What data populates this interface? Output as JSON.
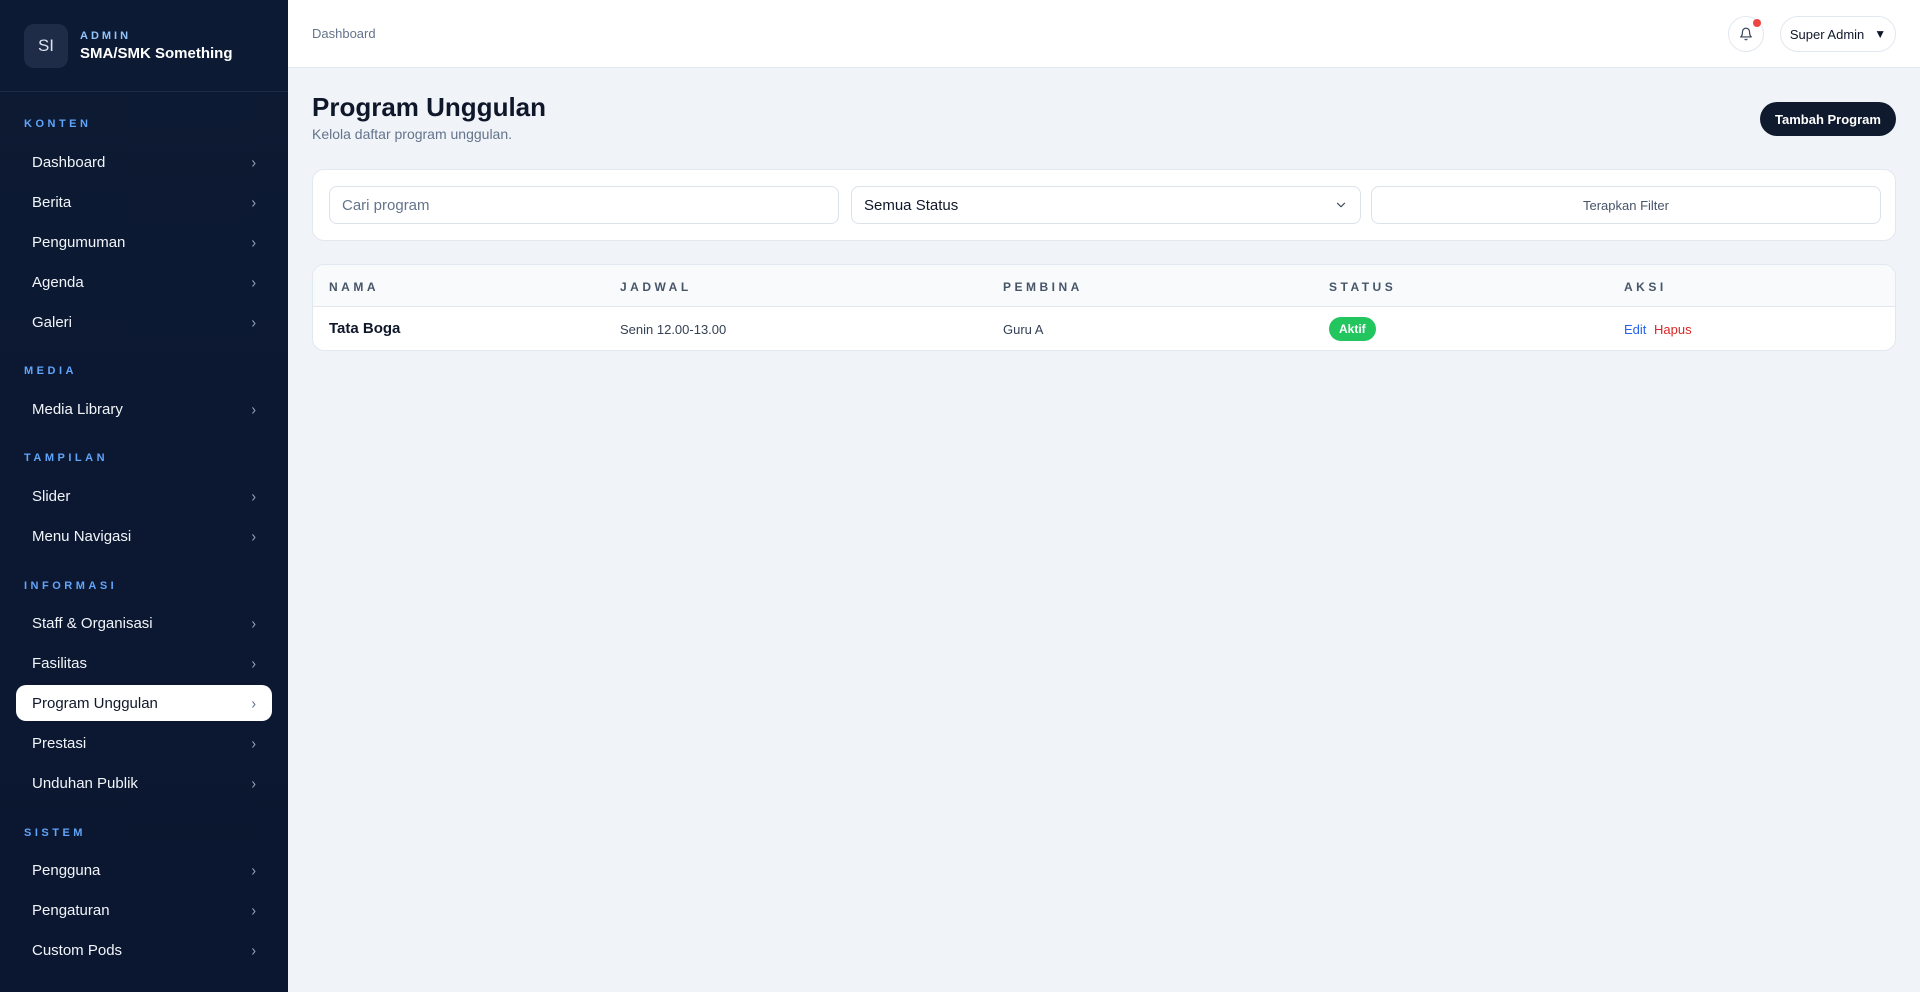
{
  "brand": {
    "initials": "SI",
    "kicker": "ADMIN",
    "name": "SMA/SMK Something"
  },
  "sidebar": {
    "sections": [
      {
        "label": "KONTEN",
        "items": [
          "Dashboard",
          "Berita",
          "Pengumuman",
          "Agenda",
          "Galeri"
        ]
      },
      {
        "label": "MEDIA",
        "items": [
          "Media Library"
        ]
      },
      {
        "label": "TAMPILAN",
        "items": [
          "Slider",
          "Menu Navigasi"
        ]
      },
      {
        "label": "INFORMASI",
        "items": [
          "Staff & Organisasi",
          "Fasilitas",
          "Program Unggulan",
          "Prestasi",
          "Unduhan Publik"
        ]
      },
      {
        "label": "SISTEM",
        "items": [
          "Pengguna",
          "Pengaturan",
          "Custom Pods"
        ]
      }
    ],
    "active_item": "Program Unggulan",
    "chevron": "›"
  },
  "topbar": {
    "breadcrumb": "Dashboard",
    "user": "Super Admin",
    "user_caret": "▼"
  },
  "page": {
    "title": "Program Unggulan",
    "subtitle": "Kelola daftar program unggulan.",
    "add_button": "Tambah Program"
  },
  "filters": {
    "search_placeholder": "Cari program",
    "search_value": "",
    "status_selected": "Semua Status",
    "apply_button": "Terapkan Filter"
  },
  "table": {
    "headers": [
      "NAMA",
      "JADWAL",
      "PEMBINA",
      "STATUS",
      "AKSI"
    ],
    "rows": [
      {
        "nama": "Tata Boga",
        "jadwal": "Senin 12.00-13.00",
        "pembina": "Guru A",
        "status": "Aktif",
        "edit": "Edit",
        "hapus": "Hapus"
      }
    ]
  },
  "colors": {
    "sidebar_bg": "#0d1a33",
    "status_active": "#22c55e",
    "edit_link": "#2563eb",
    "delete_link": "#dc2626",
    "primary_button": "#0f1a2e",
    "notification_dot": "#ef4444"
  }
}
